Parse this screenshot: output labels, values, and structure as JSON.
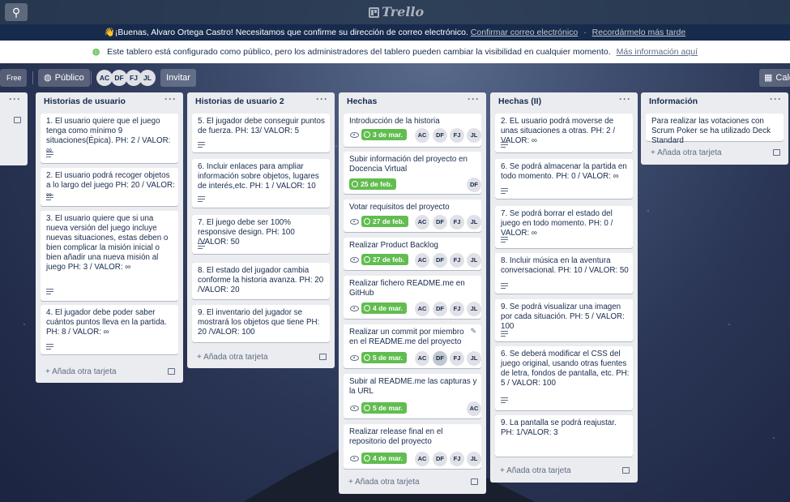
{
  "topbar": {
    "logo_text": "Trello",
    "search_icon": "search-icon"
  },
  "email_banner": {
    "text": "👋¡Buenas, Alvaro Ortega Castro! Necesitamos que confirme su dirección de correo electrónico.",
    "confirm_link": "Confirmar correo electrónico",
    "separator": "·",
    "remind_link": "Recordármelo más tarde"
  },
  "public_notice": {
    "text": "Este tablero está configurado como público, pero los administradores del tablero pueden cambiar la visibilidad en cualquier momento.",
    "more_link": "Más información aquí"
  },
  "board_header": {
    "plan_label": "Free",
    "visibility_label": "Público",
    "members": [
      "AC",
      "DF",
      "FJ",
      "JL"
    ],
    "invite_label": "Invitar",
    "calendar_label": "Cale"
  },
  "add_card_label": "+ Añada otra tarjeta",
  "lists": [
    {
      "title": "Historias de usuario",
      "cards": [
        {
          "title": "1. El usuario quiere que el juego tenga como mínimo 9 situaciones(Épica). PH: 2 / VALOR: ∞"
        },
        {
          "title": "2. El usuario podrá recoger objetos a lo largo del juego PH: 20 / VALOR: ∞"
        },
        {
          "title": "3. El usuario quiere que si una nueva versión del juego incluye nuevas situaciones, estas deben o bien complicar la misión inicial o bien añadir una nueva misión al juego PH: 3 / VALOR: ∞"
        },
        {
          "title": "4. El jugador debe poder saber cuántos puntos lleva en la partida. PH: 8 / VALOR: ∞"
        }
      ]
    },
    {
      "title": "Historias de usuario 2",
      "cards": [
        {
          "title": "5. El jugador debe conseguir puntos de fuerza. PH: 13/ VALOR: 5"
        },
        {
          "title": "6. Incluir enlaces para ampliar información sobre objetos, lugares de interés,etc. PH: 1 / VALOR: 10"
        },
        {
          "title": "7. El juego debe ser 100% responsive design. PH: 100 /VALOR: 50"
        },
        {
          "title": "8. El estado del jugador cambia conforme la historia avanza. PH: 20 /VALOR: 20"
        },
        {
          "title": "9. El inventario del jugador se mostrará los objetos que tiene PH: 20 /VALOR: 100"
        }
      ]
    },
    {
      "title": "Hechas",
      "cards": [
        {
          "title": "Introducción de la historia",
          "due": "3 de mar.",
          "members": [
            "AC",
            "DF",
            "FJ",
            "JL"
          ]
        },
        {
          "title": "Subir información del proyecto en Docencia Virtual",
          "due": "25 de feb.",
          "members": [
            "DF"
          ]
        },
        {
          "title": "Votar requisitos del proyecto",
          "due": "27 de feb.",
          "members": [
            "AC",
            "DF",
            "FJ",
            "JL"
          ]
        },
        {
          "title": "Realizar Product Backlog",
          "due": "27 de feb.",
          "members": [
            "AC",
            "DF",
            "FJ",
            "JL"
          ]
        },
        {
          "title": "Realizar fichero README.me en GitHub",
          "due": "4 de mar.",
          "members": [
            "AC",
            "DF",
            "FJ",
            "JL"
          ]
        },
        {
          "title": "Realizar un commit por miembro en el README.me del proyecto",
          "due": "5 de mar.",
          "members": [
            "AC",
            "DF",
            "FJ",
            "JL"
          ]
        },
        {
          "title": "Subir al README.me las capturas y la URL",
          "due": "5 de mar.",
          "members": [
            "AC"
          ]
        },
        {
          "title": "Realizar release final en el repositorio del proyecto",
          "due": "4 de mar.",
          "members": [
            "AC",
            "DF",
            "FJ",
            "JL"
          ]
        }
      ]
    },
    {
      "title": "Hechas (II)",
      "cards": [
        {
          "title": "2. EL usuario podrá moverse de unas situaciones a otras. PH: 2 / VALOR: ∞"
        },
        {
          "title": "6. Se podrá almacenar la partida en todo momento. PH: 0 / VALOR: ∞"
        },
        {
          "title": "7. Se podrá borrar el estado del juego en todo momento. PH: 0 / VALOR: ∞"
        },
        {
          "title": "8. Incluir música en la aventura conversacional. PH: 10 / VALOR: 50"
        },
        {
          "title": "9. Se podrá visualizar una imagen por cada situación. PH: 5 / VALOR: 100"
        },
        {
          "title": "6. Se deberá modificar el CSS del juego original, usando otras fuentes de letra, fondos de pantalla, etc. PH: 5 / VALOR: 100"
        },
        {
          "title": "9. La pantalla se podrá reajustar. PH: 1/VALOR: 3"
        }
      ]
    },
    {
      "title": "Información",
      "cards": [
        {
          "title": "Para realizar las votaciones con Scrum Poker se ha utilizado Deck Standard"
        }
      ]
    }
  ]
}
